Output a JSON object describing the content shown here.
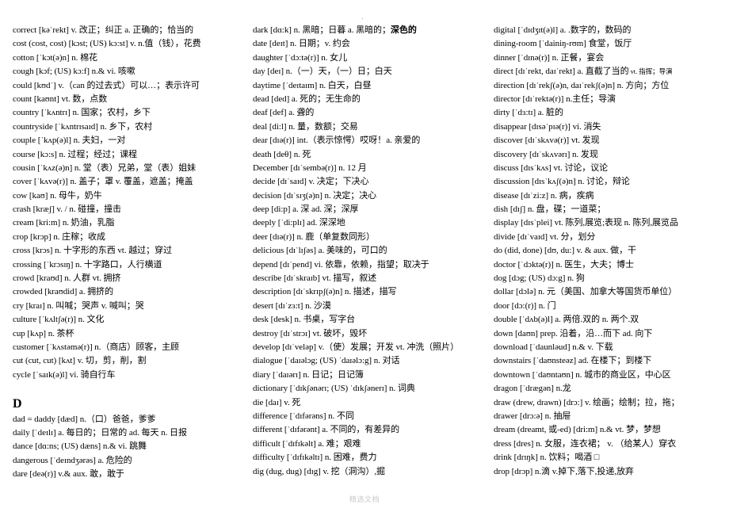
{
  "document": {
    "footer_watermark": "精选文档",
    "columns": [
      {
        "entries": [
          {
            "text": "correct [kəˈrekt] v.  改正；纠正  a.  正确的；恰当的"
          },
          {
            "text": "cost (cost, cost) [kɔst; (US) kɔ:st] v. n.值（钱），花费"
          },
          {
            "text": "cotton [ˈkɔt(ə)n] n.  棉花"
          },
          {
            "text": "cough [kɔf; (US) kɔ:f] n.& vi.  咳嗽"
          },
          {
            "text": "could  [kʊdˈ] v.（can 的过去式）可以…；表示许可"
          },
          {
            "text": "count [kaʊnt] vt.  数，点数"
          },
          {
            "text": "country [ˈkʌntrɪ] n.  国家；农村，乡下"
          },
          {
            "text": "countryside [ˈkʌntrɪsaɪd] n.  乡下，农村"
          },
          {
            "text": "couple [ˈkʌp(ə)l] n.  夫妇，一对"
          },
          {
            "text": "course [kɔ:s] n.  过程；经过；课程"
          },
          {
            "text": "cousin [ˈkʌz(ə)n] n.  堂（表）兄弟，堂（表）姐妹"
          },
          {
            "text": "cover [ˈkʌvə(r)] n.  盖子；罩  v.  覆盖，遮盖；掩盖"
          },
          {
            "text": "cow [kaʊ] n.  母牛，奶牛"
          },
          {
            "text": "crash [kræʃ] v. / n.  碰撞，撞击"
          },
          {
            "text": "cream [kri:m] n.  奶油，乳脂"
          },
          {
            "text": "crop [krɔp] n.  庄稼；收成"
          },
          {
            "text": "cross [krɔs] n.  十字形的东西  vt.  越过；穿过"
          },
          {
            "text": "crossing [ˈkrɔsɪŋ] n.  十字路口，人行横道"
          },
          {
            "text": "crowd [kraʊd] n.  人群  vt.  拥挤"
          },
          {
            "text": "crowded [kraʊdid] a.  拥挤的"
          },
          {
            "text": "cry [kraɪ] n.  叫喊；哭声  v.  喊叫；哭"
          },
          {
            "text": "culture [ˈkʌltʃə(r)] n.  文化"
          },
          {
            "text": "cup [kʌp] n.  茶杯"
          },
          {
            "text": "customer [ˈkʌstəmə(r)] n.（商店）顾客，主顾"
          },
          {
            "text": "cut (cut, cut) [kʌt] v.  切，剪，削，割"
          },
          {
            "text": "cycle [ˈsaɪk(ə)l] vi.  骑自行车"
          }
        ],
        "section_letter": "D",
        "section_entries": [
          {
            "text": "dad = daddy [dæd] n.（口）爸爸，爹爹"
          },
          {
            "text": "daily [ˈdeɪlɪ] a.  每日的；日常的  ad.  每天  n.  日报"
          },
          {
            "text": "dance [dɑ:ns; (US) dæns] n.& vi.  跳舞"
          },
          {
            "text": "dangerous [ˈdeɪndʒərəs] a.  危险的"
          },
          {
            "text": "dare [deə(r)] v.& aux.  敢，敢于"
          }
        ]
      },
      {
        "entries": [
          {
            "text": "dark [dɑ:k] n.  黑暗；日暮  a.  黑暗的；",
            "bold_suffix": "深色的"
          },
          {
            "text": "date [deɪt] n.  日期；v.  约会"
          },
          {
            "text": "daughter [ˈdɔ:tə(r)] n.  女儿"
          },
          {
            "text": "day [deɪ] n.（一）天，（一）日；白天"
          },
          {
            "text": "daytime [ˈdeɪtaɪm] n.  白天，白昼"
          },
          {
            "text": "dead [ded] a.  死的；无生命的"
          },
          {
            "text": "deaf [def] a.  聋的"
          },
          {
            "text": "deal [di:l] n.  量，数额；交易"
          },
          {
            "text": "dear [dɪə(r)] int.（表示惊愕）哎呀！a.  亲爱的"
          },
          {
            "text": "death [deθ] n.  死"
          },
          {
            "text": "December [dɪˈsembə(r)] n. 12 月"
          },
          {
            "text": "decide [dɪˈsaɪd] v.  决定；下决心"
          },
          {
            "text": "decision [dɪˈsɪʒ(ə)n] n.  决定；决心"
          },
          {
            "text": "deep [di:p] a.  深  ad.  深；深厚"
          },
          {
            "text": "deeply [ˈdi:plɪ] ad.  深深地"
          },
          {
            "text": "deer [dɪə(r)] n.  鹿（单复数同形）"
          },
          {
            "text": "delicious [dɪˈlɪʃəs] a.  美味的，可口的"
          },
          {
            "text": "depend [dɪˈpend] vi.  依靠，依赖，指望；取决于"
          },
          {
            "text": "describe [dɪˈskraɪb] vt.  描写，叙述"
          },
          {
            "text": "description [dɪˈskrɪpʃ(ə)n] n.  描述，描写"
          },
          {
            "text": "desert [dɪˈzɜ:t] n.  沙漠"
          },
          {
            "text": "desk [desk] n.  书桌，写字台"
          },
          {
            "text": "destroy [dɪˈstrɔɪ] vt.  破坏，毁坏"
          },
          {
            "text": "develop [dɪˈveləp] v.（使）发展；开发  vt.  冲洗（照片）"
          },
          {
            "text": "dialogue [ˈdaɪəlɔg; (US) ˈdaɪəlɔ:g] n.  对话"
          },
          {
            "text": "diary [ˈdaɪərɪ] n.  日记；日记簿"
          },
          {
            "text": "dictionary [ˈdɪkʃənərɪ; (US) ˈdɪkʃənerɪ] n.  词典"
          },
          {
            "text": "die [daɪ] v.  死"
          },
          {
            "text": "difference [ˈdɪfərəns] n.  不同"
          },
          {
            "text": "different [ˈdɪfərənt] a.  不同的，有差异的"
          },
          {
            "text": "difficult [ˈdɪfɪkəlt] a.  难；艰难"
          },
          {
            "text": "difficulty [ˈdɪfɪkəltɪ] n.  困难，费力"
          },
          {
            "text": "dig (dug, dug) [dɪg] v.  挖（洞沟）,掘"
          }
        ]
      },
      {
        "entries": [
          {
            "text": "digital [ˈdɪdʒɪt(ə)l] a. .数字的，数码的"
          },
          {
            "text": "dining-room [ˈdainiŋ-rʊm]  食堂，饭厅"
          },
          {
            "text": "dinner [ˈdɪnə(r)] n.  正餐，宴会"
          },
          {
            "text": "direct [dɪˈrekt, daɪˈrekt] a.  直截了当的",
            "small_suffix": "  vt.  指挥；导演"
          },
          {
            "text": "direction [dɪˈrekʃ(ə)n, daɪˈrekʃ(ə)n] n.  方向；方位"
          },
          {
            "text": "director [dɪˈrektə(r)] n.主任；导演"
          },
          {
            "text": "dirty [ˈdɜ:tɪ] a.  脏的"
          },
          {
            "text": "disappear [dɪsəˈpɪə(r)] vi.  消失"
          },
          {
            "text": "discover [dɪˈskʌvə(r)] vt.  发现"
          },
          {
            "text": "discovery [dɪˈskʌvərɪ] n.  发现"
          },
          {
            "text": "discuss [dɪsˈkʌs] vt.  讨论，议论"
          },
          {
            "text": "discussion [dɪsˈkʌʃ(ə)n] n.  讨论，辩论"
          },
          {
            "text": "disease [dɪˈzi:z] n.  病，疾病"
          },
          {
            "text": "dish [dɪʃ] n.  盘，碟；一道菜；"
          },
          {
            "text": "display  [dɪsˈplei] vt.  陈列,展览;表现  n.  陈列,展览品"
          },
          {
            "text": "divide [dɪˈvaɪd] vt.  分，划分"
          },
          {
            "text": "do (did, done) [dʊ, du:] v. & aux.  做，干"
          },
          {
            "text": "doctor [ˈdɔktə(r)] n.  医生，大夫；博士"
          },
          {
            "text": "dog [dɔg; (US) dɔ:g] n.  狗"
          },
          {
            "text": "dollar [dɔlə] n.  元（美国、加拿大等国货币单位）"
          },
          {
            "text": "door [dɔ:(r)]  n.  门"
          },
          {
            "text": "double [ˈdʌb(ə)l] a.  两倍.双的  n.  两个.双"
          },
          {
            "text": "down [daʊn] prep.  沿着，沿…而下  ad.  向下"
          },
          {
            "text": "download [ˈdaunləud] n.& v.  下载"
          },
          {
            "text": "downstairs [ˈdaʊnsteəz] ad.  在楼下；到楼下"
          },
          {
            "text": "downtown [ˈdaʊntaʊn] n.  城市的商业区，中心区"
          },
          {
            "text": "dragon [ˈdrægən] n.龙"
          },
          {
            "text": "draw (drew, drawn) [drɔ:] v.  绘画；绘制；拉，拖；"
          },
          {
            "text": "drawer [drɔ:ə] n.  抽屉"
          },
          {
            "text": "dream (dreamt,  或-ed) [dri:m] n.& vt.  梦，梦想"
          },
          {
            "text": "dress [dres] n.  女服，连衣裙；  v.  （给某人）穿衣"
          },
          {
            "text": "drink [drɪŋk] n.  饮料；喝酒  □"
          },
          {
            "text": "drop [drɔp] n.滴  v.掉下,落下,投递,放弃"
          }
        ]
      }
    ]
  }
}
